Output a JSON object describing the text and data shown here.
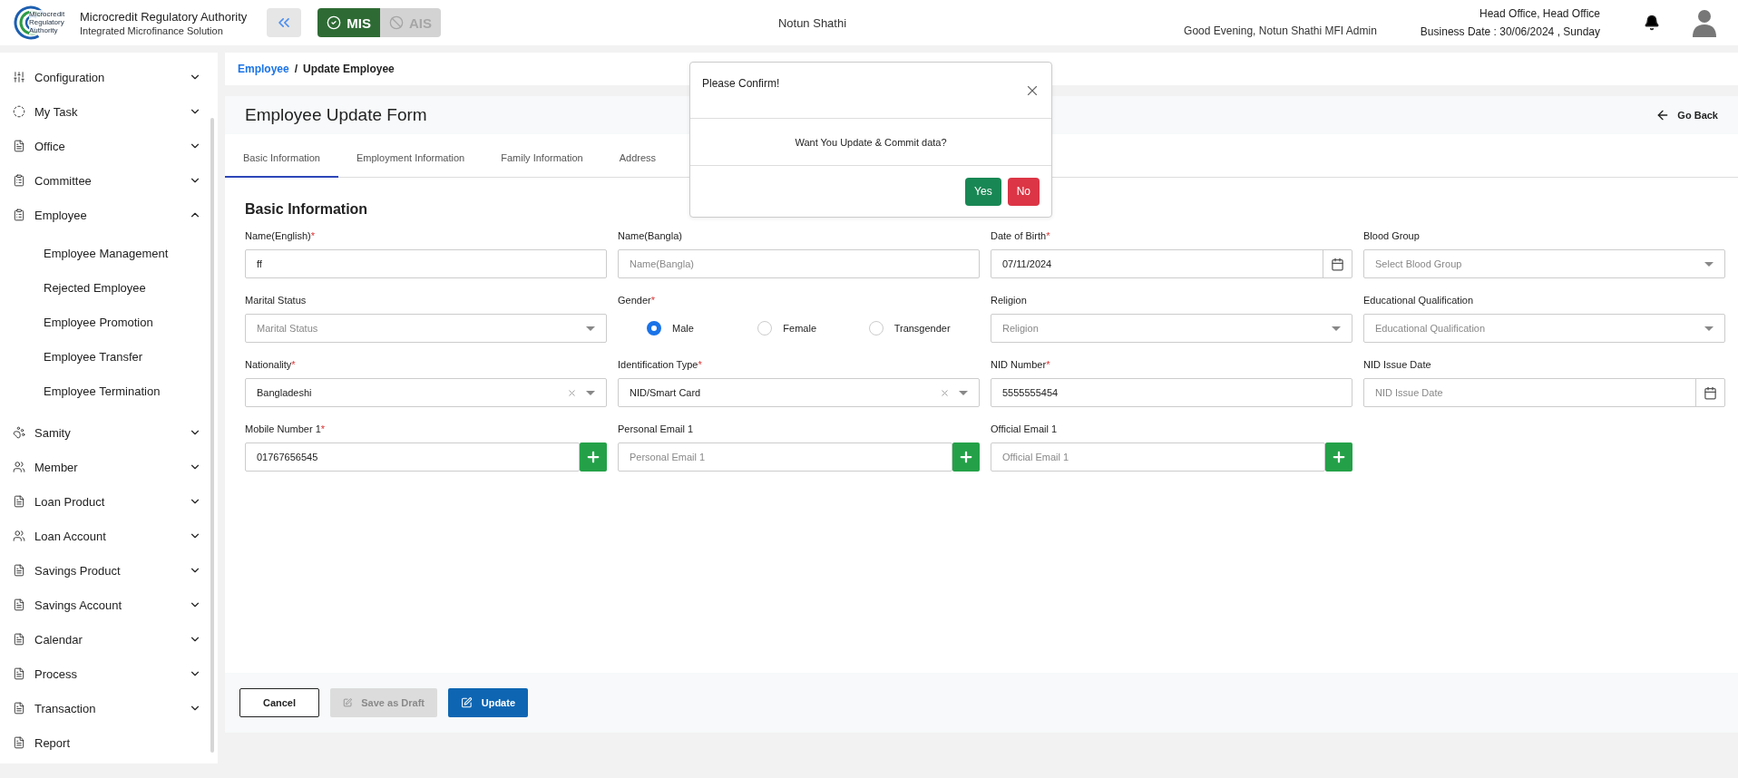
{
  "header": {
    "logo_text": [
      "Microcredit",
      "Regulatory",
      "Authority"
    ],
    "org_name": "Microcredit Regulatory Authority",
    "org_subtitle": "Integrated Microfinance Solution",
    "modules": [
      {
        "label": "MIS",
        "selected": true
      },
      {
        "label": "AIS",
        "selected": false
      }
    ],
    "center_title": "Notun Shathi",
    "greeting": "Good Evening, Notun Shathi MFI Admin",
    "office": "Head Office, Head Office",
    "business_date": "Business Date : 30/06/2024 , Sunday"
  },
  "sidebar": {
    "items": [
      {
        "label": "Configuration",
        "expanded": false
      },
      {
        "label": "My Task",
        "expanded": false
      },
      {
        "label": "Office",
        "expanded": false
      },
      {
        "label": "Committee",
        "expanded": false
      },
      {
        "label": "Employee",
        "expanded": true,
        "children": [
          {
            "label": "Employee Management"
          },
          {
            "label": "Rejected Employee"
          },
          {
            "label": "Employee Promotion"
          },
          {
            "label": "Employee Transfer"
          },
          {
            "label": "Employee Termination"
          }
        ]
      },
      {
        "label": "Samity",
        "expanded": false
      },
      {
        "label": "Member",
        "expanded": false
      },
      {
        "label": "Loan Product",
        "expanded": false
      },
      {
        "label": "Loan Account",
        "expanded": false
      },
      {
        "label": "Savings Product",
        "expanded": false
      },
      {
        "label": "Savings Account",
        "expanded": false
      },
      {
        "label": "Calendar",
        "expanded": false
      },
      {
        "label": "Process",
        "expanded": false
      },
      {
        "label": "Transaction",
        "expanded": false
      },
      {
        "label": "Report"
      }
    ]
  },
  "breadcrumb": {
    "parent": "Employee",
    "separator": "/",
    "current": "Update Employee"
  },
  "form": {
    "title": "Employee Update Form",
    "back": "Go Back",
    "tabs": [
      {
        "label": "Basic Information",
        "selected": true
      },
      {
        "label": "Employment Information",
        "selected": false
      },
      {
        "label": "Family Information",
        "selected": false
      },
      {
        "label": "Address",
        "selected": false
      }
    ],
    "section_title": "Basic Information",
    "required_mark": "*",
    "fields": [
      {
        "kind": "text",
        "label": "Name(English)",
        "required": true,
        "value": "ff"
      },
      {
        "kind": "text",
        "label": "Name(Bangla)",
        "required": false,
        "placeholder": "Name(Bangla)"
      },
      {
        "kind": "date",
        "label": "Date of Birth",
        "required": true,
        "value": "07/11/2024"
      },
      {
        "kind": "select",
        "label": "Blood Group",
        "required": false,
        "placeholder": "Select Blood Group"
      },
      {
        "kind": "select",
        "label": "Marital Status",
        "required": false,
        "placeholder": "Marital Status"
      },
      {
        "kind": "radio",
        "label": "Gender",
        "required": true,
        "options": [
          {
            "label": "Male",
            "selected": true
          },
          {
            "label": "Female",
            "selected": false
          },
          {
            "label": "Transgender",
            "selected": false
          }
        ]
      },
      {
        "kind": "select",
        "label": "Religion",
        "required": false,
        "placeholder": "Religion"
      },
      {
        "kind": "select",
        "label": "Educational Qualification",
        "required": false,
        "placeholder": "Educational Qualification"
      },
      {
        "kind": "clearable",
        "label": "Nationality",
        "required": true,
        "value": "Bangladeshi"
      },
      {
        "kind": "clearable",
        "label": "Identification Type",
        "required": true,
        "value": "NID/Smart Card"
      },
      {
        "kind": "text",
        "label": "NID Number",
        "required": true,
        "value": "5555555454"
      },
      {
        "kind": "date",
        "label": "NID Issue Date",
        "required": false,
        "placeholder": "NID Issue Date"
      },
      {
        "kind": "addable",
        "label": "Mobile Number 1",
        "required": true,
        "value": "01767656545"
      },
      {
        "kind": "addable",
        "label": "Personal Email 1",
        "required": false,
        "placeholder": "Personal Email 1"
      },
      {
        "kind": "addable",
        "label": "Official Email 1",
        "required": false,
        "placeholder": "Official Email 1"
      }
    ],
    "buttons": [
      {
        "kind": "cancel",
        "label": "Cancel",
        "disabled": false
      },
      {
        "kind": "draft",
        "label": "Save as Draft",
        "disabled": true
      },
      {
        "kind": "update",
        "label": "Update",
        "disabled": false
      }
    ]
  },
  "dialog": {
    "title": "Please Confirm!",
    "message": "Want You Update & Commit data?",
    "buttons": [
      {
        "kind": "confirm",
        "label": "Yes"
      },
      {
        "kind": "deny",
        "label": "No"
      }
    ]
  }
}
